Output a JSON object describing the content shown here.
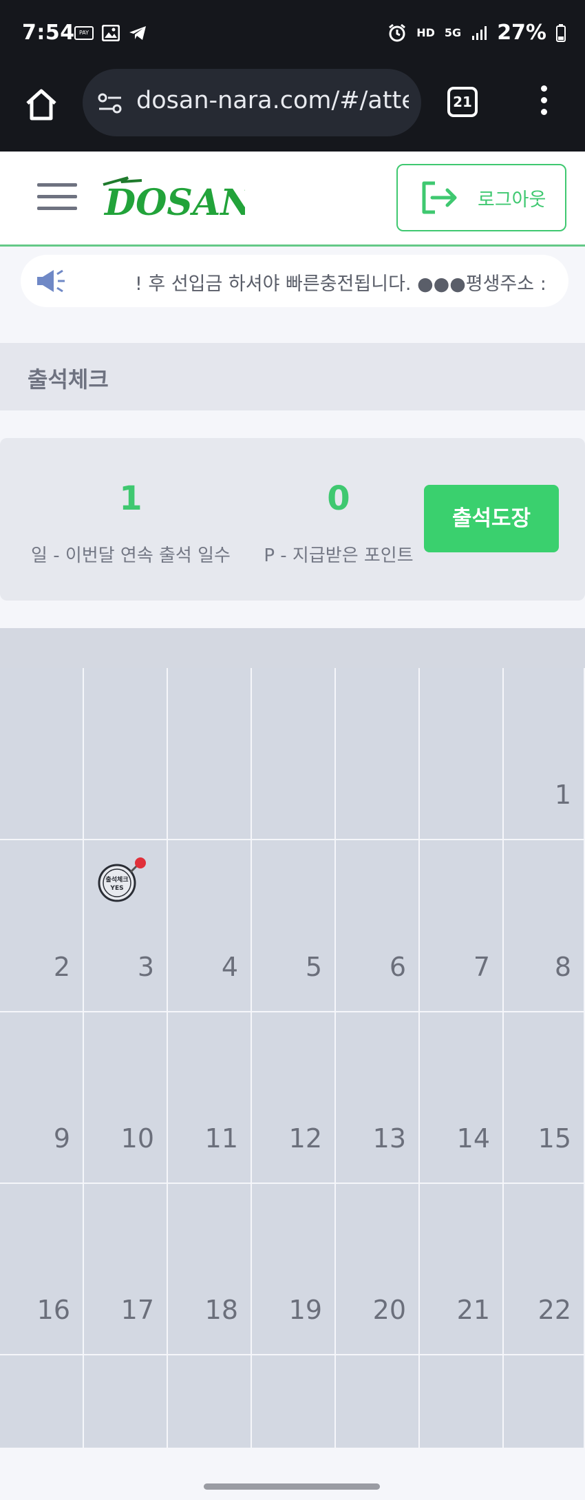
{
  "status_bar": {
    "time": "7:54",
    "left_icons": [
      "payco-icon",
      "image-icon",
      "telegram-icon"
    ],
    "right_icons": [
      "alarm-icon",
      "hd-voice-icon",
      "5g-icon",
      "signal-icon"
    ],
    "hd_label": "HD",
    "net_label": "5G",
    "battery": "27%"
  },
  "browser": {
    "url": "dosan-nara.com/#/attendance",
    "tab_count": "21"
  },
  "header": {
    "logo_text": "DOSAN",
    "logout_label": "로그아웃"
  },
  "notice": {
    "text": "! 후 선입금 하셔야 빠른충전됩니다. ●●●평생주소 :"
  },
  "section": {
    "title": "출석체크"
  },
  "stats": {
    "streak_value": "1",
    "streak_label": "일 - 이번달 연속 출석 일수",
    "points_value": "0",
    "points_label": "P - 지급받은 포인트",
    "attend_button": "출석도장"
  },
  "calendar": {
    "rows": [
      [
        "",
        "",
        "",
        "",
        "",
        "",
        "1"
      ],
      [
        "2",
        "3",
        "4",
        "5",
        "6",
        "7",
        "8"
      ],
      [
        "9",
        "10",
        "11",
        "12",
        "13",
        "14",
        "15"
      ],
      [
        "16",
        "17",
        "18",
        "19",
        "20",
        "21",
        "22"
      ],
      [
        "",
        "",
        "",
        "",
        "",
        "",
        ""
      ]
    ],
    "stamp_text": "출석체크",
    "stamp_yes": "YES",
    "stamped_day": "3",
    "accent": "#3fc870"
  }
}
